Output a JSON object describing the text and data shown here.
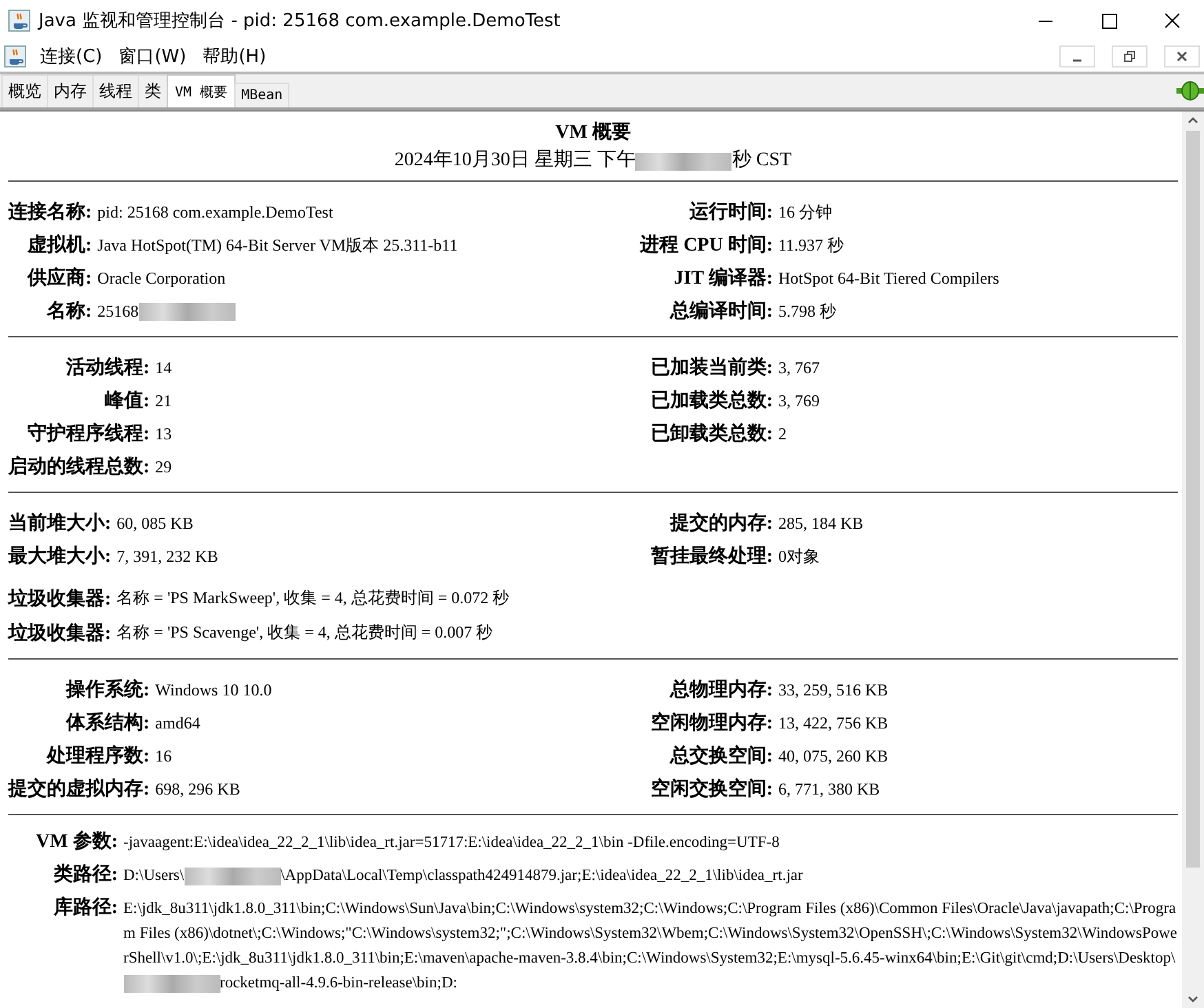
{
  "window": {
    "title": "Java 监视和管理控制台 - pid: 25168 com.example.DemoTest"
  },
  "menu": [
    {
      "label": "连接(C)"
    },
    {
      "label": "窗口(W)"
    },
    {
      "label": "帮助(H)"
    }
  ],
  "tabs": [
    {
      "label": "概览",
      "selected": false
    },
    {
      "label": "内存",
      "selected": false
    },
    {
      "label": "线程",
      "selected": false
    },
    {
      "label": "类",
      "selected": false
    },
    {
      "label": "VM 概要",
      "selected": true
    },
    {
      "label": "MBean",
      "selected": false
    }
  ],
  "summary": {
    "title": "VM 概要",
    "timestamp": [
      {
        "kind": "text",
        "text": "2024年10月30日 星期三 下午"
      },
      {
        "kind": "redacted"
      },
      {
        "kind": "text",
        "text": "秒 CST"
      }
    ]
  },
  "sections": [
    {
      "blocks": [
        {
          "kind": "two_column",
          "left": [
            {
              "label": "连接名称:",
              "value": "pid: 25168 com.example.DemoTest"
            },
            {
              "label": "虚拟机:",
              "value": "Java HotSpot(TM) 64-Bit Server VM版本 25.311-b11"
            },
            {
              "label": "供应商:",
              "value": "Oracle Corporation"
            },
            {
              "label": "名称:",
              "value": [
                {
                  "kind": "text",
                  "text": "25168"
                },
                {
                  "kind": "redacted"
                }
              ]
            }
          ],
          "right": [
            {
              "label": "运行时间:",
              "value": "16 分钟"
            },
            {
              "label": "进程 CPU 时间:",
              "value": "11.937 秒"
            },
            {
              "label": "JIT 编译器:",
              "value": "HotSpot 64-Bit Tiered Compilers"
            },
            {
              "label": "总编译时间:",
              "value": "5.798 秒"
            }
          ]
        }
      ]
    },
    {
      "blocks": [
        {
          "kind": "two_column",
          "left": [
            {
              "label": "活动线程:",
              "value": "14"
            },
            {
              "label": "峰值:",
              "value": "21"
            },
            {
              "label": "守护程序线程:",
              "value": "13"
            },
            {
              "label": "启动的线程总数:",
              "value": "29"
            }
          ],
          "right": [
            {
              "label": "已加装当前类:",
              "value": "3, 767"
            },
            {
              "label": "已加载类总数:",
              "value": "3, 769"
            },
            {
              "label": "已卸载类总数:",
              "value": "2"
            }
          ]
        }
      ]
    },
    {
      "blocks": [
        {
          "kind": "two_column",
          "left": [
            {
              "label": "当前堆大小:",
              "value": "60, 085 KB"
            },
            {
              "label": "最大堆大小:",
              "value": "7, 391, 232 KB"
            }
          ],
          "right": [
            {
              "label": "提交的内存:",
              "value": "285, 184 KB"
            },
            {
              "label": "暂挂最终处理:",
              "value": "0对象"
            }
          ]
        },
        {
          "kind": "wide",
          "items": [
            {
              "label": "垃圾收集器:",
              "value": "名称 = 'PS MarkSweep', 收集 = 4, 总花费时间 = 0.072 秒"
            },
            {
              "label": "垃圾收集器:",
              "value": "名称 = 'PS Scavenge', 收集 = 4, 总花费时间 = 0.007 秒"
            }
          ]
        }
      ]
    },
    {
      "blocks": [
        {
          "kind": "two_column",
          "left": [
            {
              "label": "操作系统:",
              "value": "Windows 10 10.0"
            },
            {
              "label": "体系结构:",
              "value": "amd64"
            },
            {
              "label": "处理程序数:",
              "value": "16"
            },
            {
              "label": "提交的虚拟内存:",
              "value": "698, 296 KB"
            }
          ],
          "right": [
            {
              "label": "总物理内存:",
              "value": "33, 259, 516 KB"
            },
            {
              "label": "空闲物理内存:",
              "value": "13, 422, 756 KB"
            },
            {
              "label": "总交换空间:",
              "value": "40, 075, 260 KB"
            },
            {
              "label": "空闲交换空间:",
              "value": "6, 771, 380 KB"
            }
          ]
        }
      ]
    },
    {
      "blocks": [
        {
          "kind": "paths",
          "items": [
            {
              "label": "VM 参数:",
              "value": "-javaagent:E:\\idea\\idea_22_2_1\\lib\\idea_rt.jar=51717:E:\\idea\\idea_22_2_1\\bin -Dfile.encoding=UTF-8"
            },
            {
              "label": "类路径:",
              "value": [
                {
                  "kind": "text",
                  "text": "D:\\Users\\"
                },
                {
                  "kind": "redacted"
                },
                {
                  "kind": "text",
                  "text": "\\AppData\\Local\\Temp\\classpath424914879.jar;E:\\idea\\idea_22_2_1\\lib\\idea_rt.jar"
                }
              ]
            },
            {
              "label": "库路径:",
              "value": [
                {
                  "kind": "text",
                  "text": "E:\\jdk_8u311\\jdk1.8.0_311\\bin;C:\\Windows\\Sun\\Java\\bin;C:\\Windows\\system32;C:\\Windows;C:\\Program Files (x86)\\Common Files\\Oracle\\Java\\javapath;C:\\Program Files (x86)\\dotnet\\;C:\\Windows;\"C:\\Windows\\system32;\";C:\\Windows\\System32\\Wbem;C:\\Windows\\System32\\OpenSSH\\;C:\\Windows\\System32\\WindowsPowerShell\\v1.0\\;E:\\jdk_8u311\\jdk1.8.0_311\\bin;E:\\maven\\apache-maven-3.8.4\\bin;C:\\Windows\\System32;E:\\mysql-5.6.45-winx64\\bin;E:\\Git\\git\\cmd;D:\\Users\\Desktop\\"
                },
                {
                  "kind": "redacted"
                },
                {
                  "kind": "text",
                  "text": "rocketmq-all-4.9.6-bin-release\\bin;D:"
                }
              ]
            }
          ]
        }
      ]
    }
  ]
}
